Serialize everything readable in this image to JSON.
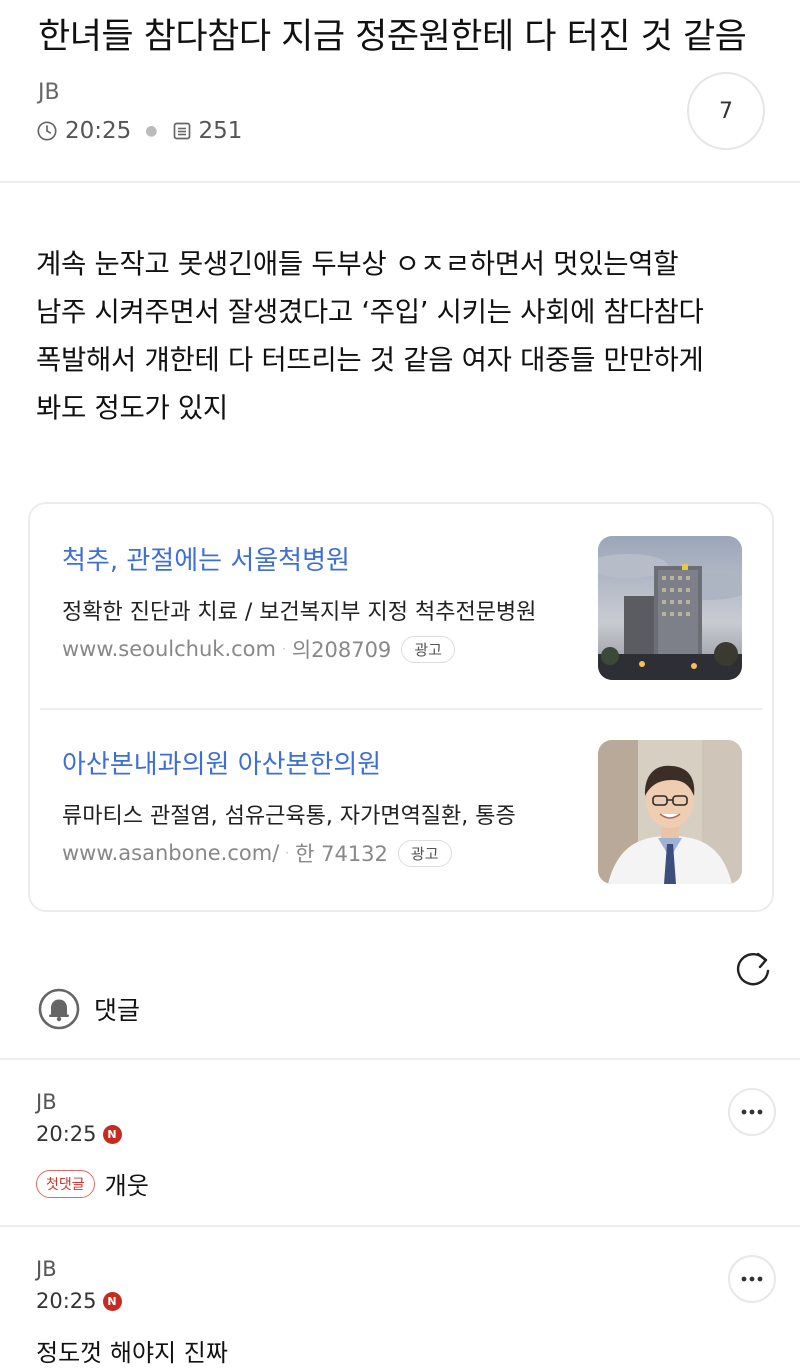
{
  "post": {
    "title": "한녀들 참다참다 지금 정준원한테 다 터진 것 같음",
    "author": "JB",
    "time": "20:25",
    "views": "251",
    "comment_count": "7",
    "body_lines": [
      "계속 눈작고 못생긴애들 두부상 ㅇㅈㄹ하면서 멋있는역할",
      "남주 시켜주면서 잘생겼다고 ‘주입’ 시키는 사회에 참다참다",
      "폭발해서 걔한테 다 터뜨리는 것 같음 여자 대중들 만만하게",
      "봐도 정도가 있지"
    ]
  },
  "ads": [
    {
      "title": "척추, 관절에는 서울척병원",
      "desc": "정확한 진단과 치료 / 보건복지부 지정 척추전문병원",
      "url": "www.seoulchuk.com",
      "code": "의208709",
      "badge": "광고"
    },
    {
      "title": "아산본내과의원 아산본한의원",
      "desc": "류마티스 관절염, 섬유근육통, 자가면역질환, 통증",
      "url": "www.asanbone.com/",
      "code": "한 74132",
      "badge": "광고"
    }
  ],
  "comments_section": {
    "label": "댓글"
  },
  "comments": [
    {
      "author": "JB",
      "time": "20:25",
      "new_badge": "N",
      "first_badge": "첫댓글",
      "text": "개웃"
    },
    {
      "author": "JB",
      "time": "20:25",
      "new_badge": "N",
      "text": "정도껏 해야지 진짜"
    }
  ],
  "colors": {
    "ad_title": "#3d6fd6",
    "new_badge": "#c62b22",
    "first_badge": "#d2342b"
  },
  "icons": [
    "clock-icon",
    "document-icon",
    "refresh-icon",
    "bell-icon",
    "more-icon"
  ]
}
